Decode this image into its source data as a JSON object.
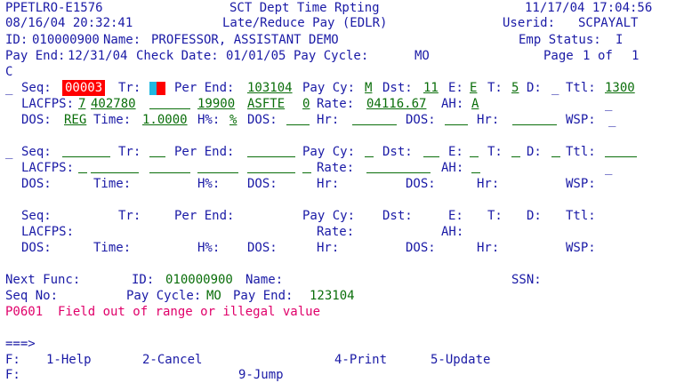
{
  "header": {
    "program": "PPETLRO-E1576",
    "system_title": "SCT Dept Time Rpting",
    "datetime_left": "08/16/04 20:32:41",
    "screen_title": "Late/Reduce Pay (EDLR)",
    "datetime_right": "11/17/04 17:04:56",
    "userid_label": "Userid:",
    "userid": "SCPAYALT",
    "id_label": "ID:",
    "id": "010000900",
    "name_label": "Name:",
    "name": "PROFESSOR, ASSISTANT DEMO",
    "emp_status_label": "Emp Status:",
    "emp_status": "I",
    "pay_end_label": "Pay End:",
    "pay_end": "12/31/04",
    "check_date_label": "Check Date:",
    "check_date": "01/01/05",
    "pay_cycle_label": "Pay Cycle:",
    "pay_cycle": "MO",
    "page_label": "Page",
    "page_num": "1",
    "page_of": "of",
    "page_total": "1",
    "extra_line": "C"
  },
  "labels": {
    "seq": "Seq:",
    "tr": "Tr:",
    "per_end": "Per End:",
    "pay_cy": "Pay Cy:",
    "dst": "Dst:",
    "e": "E:",
    "t": "T:",
    "d": "D:",
    "ttl": "Ttl:",
    "lacfps": "LACFPS:",
    "rate": "Rate:",
    "ah": "AH:",
    "dos": "DOS:",
    "time": "Time:",
    "hpct": "H%:",
    "hr": "Hr:",
    "wsp": "WSP:",
    "underscore": "_"
  },
  "record1": {
    "seq": "00003",
    "per_end": "103104",
    "pay_cy": "M",
    "dst": "11",
    "e": "E",
    "t": "5",
    "ttl": "1300",
    "lacfps_1": "7",
    "lacfps_2": "402780",
    "lacfps_3": "19900",
    "lacfps_4": "ASFTE",
    "lacfps_5": "0",
    "rate": "04116.67",
    "ah": "A",
    "dos": "REG",
    "time": "1.0000",
    "hpct": "%"
  },
  "footer": {
    "next_func_label": "Next Func:",
    "id_label": "ID:",
    "id": "010000900",
    "name_label": "Name:",
    "ssn_label": "SSN:",
    "seq_no_label": "Seq No:",
    "pay_cycle_label": "Pay Cycle:",
    "pay_cycle": "MO",
    "pay_end_label": "Pay End:",
    "pay_end": "123104",
    "error_message": "P0601  Field out of range or illegal value",
    "prompt": "===>",
    "f1_label": "F:",
    "f2_label": "F:",
    "keys": {
      "help": "1-Help",
      "cancel": "2-Cancel",
      "print": "4-Print",
      "update": "5-Update",
      "jump": "9-Jump"
    }
  },
  "colors": {
    "text_blue": "#1a1aa6",
    "value_green": "#0a6e0a",
    "error_pink": "#e0006a",
    "highlight_red": "#ff0000",
    "cursor_cyan": "#20b8e0"
  }
}
